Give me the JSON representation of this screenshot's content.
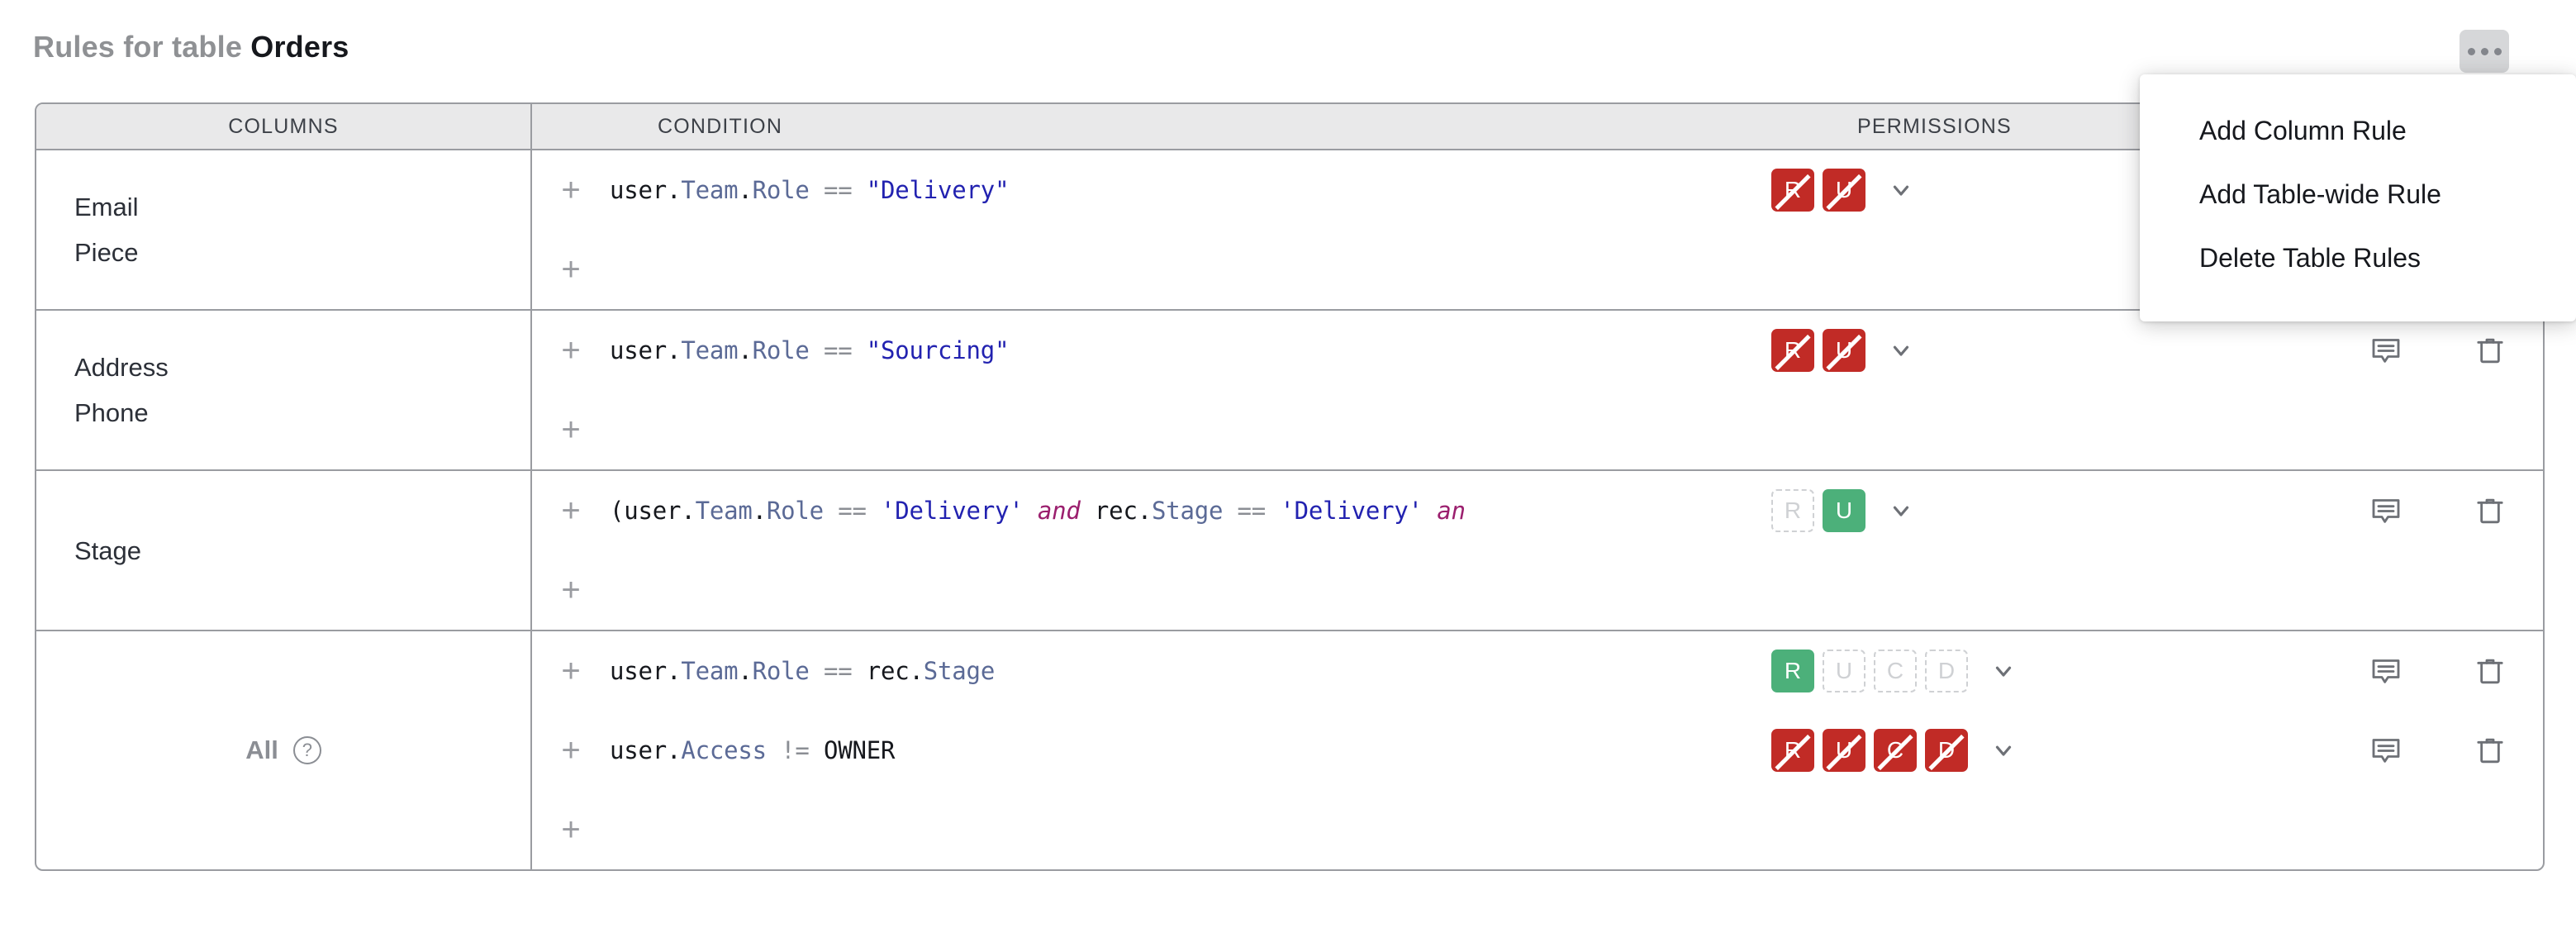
{
  "header": {
    "title_prefix": "Rules for table ",
    "table_name": "Orders",
    "more_button_label": "…"
  },
  "colors": {
    "deny": "#C12B26",
    "allow": "#4CB07A",
    "empty_border": "#CFD1D4",
    "border": "#9A9CA1",
    "header_bg": "#E9E9EA"
  },
  "table": {
    "headers": {
      "columns": "COLUMNS",
      "condition": "CONDITION",
      "permissions": "PERMISSIONS"
    },
    "rows": [
      {
        "columns": [
          "Email",
          "Piece"
        ],
        "is_all": false,
        "lines": [
          {
            "add_icon": "plus-icon",
            "tokens": [
              {
                "t": "user",
                "c": "plain"
              },
              {
                "t": ".",
                "c": "plain"
              },
              {
                "t": "Team",
                "c": "attr"
              },
              {
                "t": ".",
                "c": "plain"
              },
              {
                "t": "Role",
                "c": "attr"
              },
              {
                "t": " ",
                "c": "plain"
              },
              {
                "t": "==",
                "c": "op"
              },
              {
                "t": " ",
                "c": "plain"
              },
              {
                "t": "\"Delivery\"",
                "c": "str"
              }
            ],
            "permissions": [
              {
                "letter": "R",
                "state": "deny"
              },
              {
                "letter": "U",
                "state": "deny"
              }
            ],
            "chevron": "chevron-down-icon",
            "actions": [
              "comment-icon",
              "trash-icon"
            ],
            "actions_visible": false
          },
          {
            "add_icon": "plus-icon",
            "tokens": [],
            "permissions": [],
            "chevron": null,
            "actions": [],
            "actions_visible": false
          }
        ]
      },
      {
        "columns": [
          "Address",
          "Phone"
        ],
        "is_all": false,
        "lines": [
          {
            "add_icon": "plus-icon",
            "tokens": [
              {
                "t": "user",
                "c": "plain"
              },
              {
                "t": ".",
                "c": "plain"
              },
              {
                "t": "Team",
                "c": "attr"
              },
              {
                "t": ".",
                "c": "plain"
              },
              {
                "t": "Role",
                "c": "attr"
              },
              {
                "t": " ",
                "c": "plain"
              },
              {
                "t": "==",
                "c": "op"
              },
              {
                "t": " ",
                "c": "plain"
              },
              {
                "t": "\"Sourcing\"",
                "c": "str"
              }
            ],
            "permissions": [
              {
                "letter": "R",
                "state": "deny"
              },
              {
                "letter": "U",
                "state": "deny"
              }
            ],
            "chevron": "chevron-down-icon",
            "actions": [
              "comment-icon",
              "trash-icon"
            ],
            "actions_visible": true
          },
          {
            "add_icon": "plus-icon",
            "tokens": [],
            "permissions": [],
            "chevron": null,
            "actions": [],
            "actions_visible": false
          }
        ]
      },
      {
        "columns": [
          "Stage"
        ],
        "is_all": false,
        "lines": [
          {
            "add_icon": "plus-icon",
            "tokens": [
              {
                "t": "(",
                "c": "plain"
              },
              {
                "t": "user",
                "c": "plain"
              },
              {
                "t": ".",
                "c": "plain"
              },
              {
                "t": "Team",
                "c": "attr"
              },
              {
                "t": ".",
                "c": "plain"
              },
              {
                "t": "Role",
                "c": "attr"
              },
              {
                "t": " ",
                "c": "plain"
              },
              {
                "t": "==",
                "c": "op"
              },
              {
                "t": " ",
                "c": "plain"
              },
              {
                "t": "'Delivery'",
                "c": "str"
              },
              {
                "t": " ",
                "c": "plain"
              },
              {
                "t": "and",
                "c": "kw"
              },
              {
                "t": " ",
                "c": "plain"
              },
              {
                "t": "rec",
                "c": "plain"
              },
              {
                "t": ".",
                "c": "plain"
              },
              {
                "t": "Stage",
                "c": "attr"
              },
              {
                "t": " ",
                "c": "plain"
              },
              {
                "t": "==",
                "c": "op"
              },
              {
                "t": " ",
                "c": "plain"
              },
              {
                "t": "'Delivery'",
                "c": "str"
              },
              {
                "t": " ",
                "c": "plain"
              },
              {
                "t": "an",
                "c": "kw"
              }
            ],
            "truncated": true,
            "permissions": [
              {
                "letter": "R",
                "state": "empty"
              },
              {
                "letter": "U",
                "state": "allow"
              }
            ],
            "chevron": "chevron-down-icon",
            "actions": [
              "comment-icon",
              "trash-icon"
            ],
            "actions_visible": true
          },
          {
            "add_icon": "plus-icon",
            "tokens": [],
            "permissions": [],
            "chevron": null,
            "actions": [],
            "actions_visible": false
          }
        ]
      },
      {
        "columns": [],
        "is_all": true,
        "all_label": "All",
        "help_icon": "help-circle-icon",
        "help_glyph": "?",
        "lines": [
          {
            "add_icon": "plus-icon",
            "tokens": [
              {
                "t": "user",
                "c": "plain"
              },
              {
                "t": ".",
                "c": "plain"
              },
              {
                "t": "Team",
                "c": "attr"
              },
              {
                "t": ".",
                "c": "plain"
              },
              {
                "t": "Role",
                "c": "attr"
              },
              {
                "t": " ",
                "c": "plain"
              },
              {
                "t": "==",
                "c": "op"
              },
              {
                "t": " ",
                "c": "plain"
              },
              {
                "t": "rec",
                "c": "plain"
              },
              {
                "t": ".",
                "c": "plain"
              },
              {
                "t": "Stage",
                "c": "attr"
              }
            ],
            "permissions": [
              {
                "letter": "R",
                "state": "allow"
              },
              {
                "letter": "U",
                "state": "empty"
              },
              {
                "letter": "C",
                "state": "empty"
              },
              {
                "letter": "D",
                "state": "empty"
              }
            ],
            "chevron": "chevron-down-icon",
            "actions": [
              "comment-icon",
              "trash-icon"
            ],
            "actions_visible": true
          },
          {
            "add_icon": "plus-icon",
            "tokens": [
              {
                "t": "user",
                "c": "plain"
              },
              {
                "t": ".",
                "c": "plain"
              },
              {
                "t": "Access",
                "c": "attr"
              },
              {
                "t": " ",
                "c": "plain"
              },
              {
                "t": "!=",
                "c": "op"
              },
              {
                "t": " ",
                "c": "plain"
              },
              {
                "t": "OWNER",
                "c": "plain"
              }
            ],
            "permissions": [
              {
                "letter": "R",
                "state": "deny"
              },
              {
                "letter": "U",
                "state": "deny"
              },
              {
                "letter": "C",
                "state": "deny"
              },
              {
                "letter": "D",
                "state": "deny"
              }
            ],
            "chevron": "chevron-down-icon",
            "actions": [
              "comment-icon",
              "trash-icon"
            ],
            "actions_visible": true
          },
          {
            "add_icon": "plus-icon",
            "tokens": [],
            "permissions": [],
            "chevron": null,
            "actions": [],
            "actions_visible": false
          }
        ]
      }
    ]
  },
  "menu": {
    "items": [
      {
        "label": "Add Column Rule"
      },
      {
        "label": "Add Table-wide Rule"
      },
      {
        "label": "Delete Table Rules"
      }
    ]
  }
}
